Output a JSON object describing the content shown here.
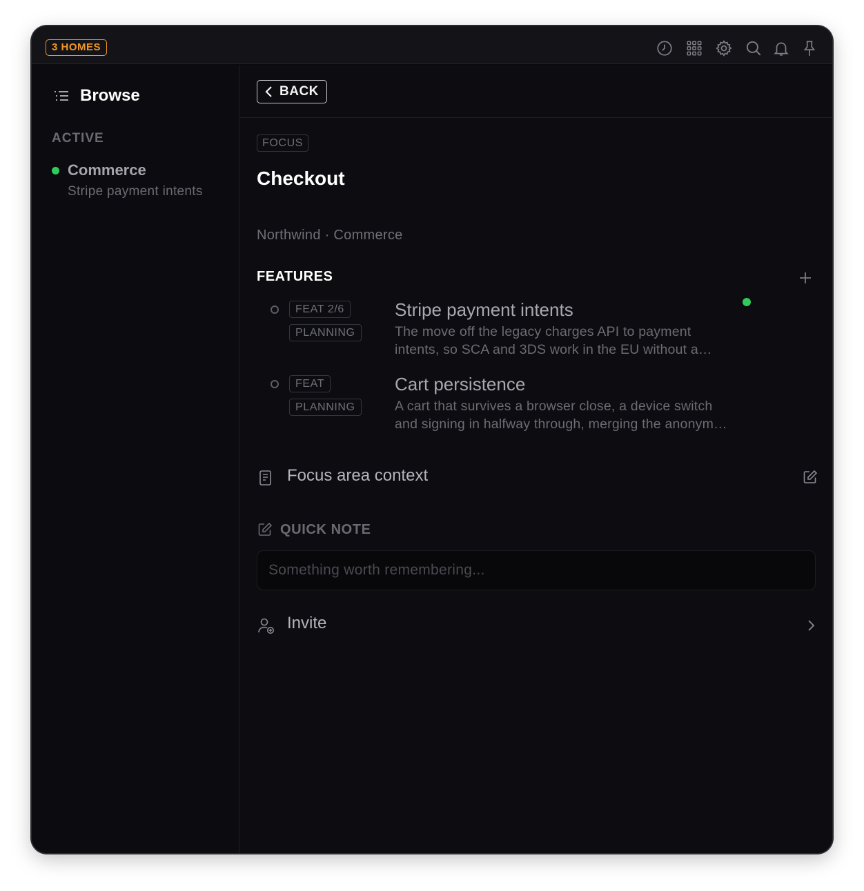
{
  "titlebar": {
    "homes_badge": "3 HOMES",
    "icons": [
      "clock-icon",
      "grid-icon",
      "gear-icon",
      "search-icon",
      "bell-icon",
      "pin-icon"
    ],
    "accent_color": "#f0962a"
  },
  "sidebar": {
    "title": "Browse",
    "section_label": "ACTIVE",
    "items": [
      {
        "label": "Commerce",
        "subtitle": "Stripe payment intents",
        "status_color": "#2fcc5a"
      }
    ]
  },
  "main": {
    "back_label": "BACK",
    "tag": "FOCUS",
    "title": "Checkout",
    "breadcrumb": "Northwind · Commerce",
    "features_label": "FEATURES",
    "features": [
      {
        "tag": "FEAT 2/6",
        "status": "PLANNING",
        "title": "Stripe payment intents",
        "desc_line1": "The move off the legacy charges API to payment",
        "desc_line2": "intents, so SCA and 3DS work in the EU without a…",
        "active": true
      },
      {
        "tag": "FEAT",
        "status": "PLANNING",
        "title": "Cart persistence",
        "desc_line1": "A cart that survives a browser close, a device switch",
        "desc_line2": "and signing in halfway through, merging the anonym…",
        "active": false
      }
    ],
    "context_label": "Focus area context",
    "quick_note": {
      "label": "QUICK NOTE",
      "placeholder": "Something worth remembering...",
      "value": ""
    },
    "invite_label": "Invite"
  }
}
